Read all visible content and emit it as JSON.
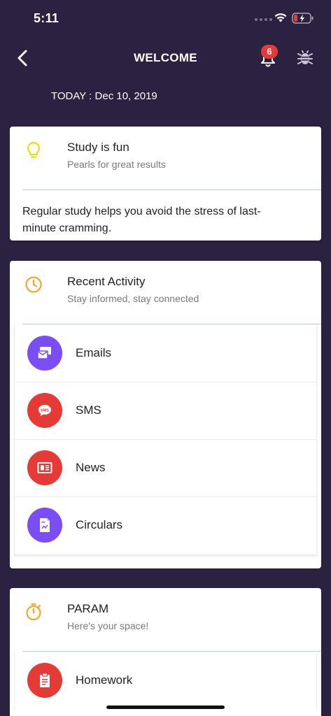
{
  "status": {
    "time": "5:11"
  },
  "nav": {
    "title": "WELCOME",
    "notification_count": "6"
  },
  "date_line": "TODAY : Dec 10, 2019",
  "tip_card": {
    "title": "Study is fun",
    "subtitle": "Pearls for great results",
    "body": "Regular study helps you avoid the stress of last-minute cramming.",
    "icon": "lightbulb-icon",
    "icon_color": "#f5d90a"
  },
  "activity_card": {
    "title": "Recent Activity",
    "subtitle": "Stay informed, stay connected",
    "icon": "clock-icon",
    "icon_color": "#f5a623",
    "items": [
      {
        "label": "Emails",
        "icon": "email-icon",
        "color": "#7a4df5"
      },
      {
        "label": "SMS",
        "icon": "sms-icon",
        "color": "#e53a35"
      },
      {
        "label": "News",
        "icon": "newspaper-icon",
        "color": "#e53a35"
      },
      {
        "label": "Circulars",
        "icon": "document-icon",
        "color": "#7a4df5"
      }
    ]
  },
  "param_card": {
    "title": "PARAM",
    "subtitle": "Here's your space!",
    "icon": "stopwatch-icon",
    "icon_color": "#f5a623",
    "items": [
      {
        "label": "Homework",
        "icon": "clipboard-icon",
        "color": "#e53a35"
      }
    ]
  }
}
